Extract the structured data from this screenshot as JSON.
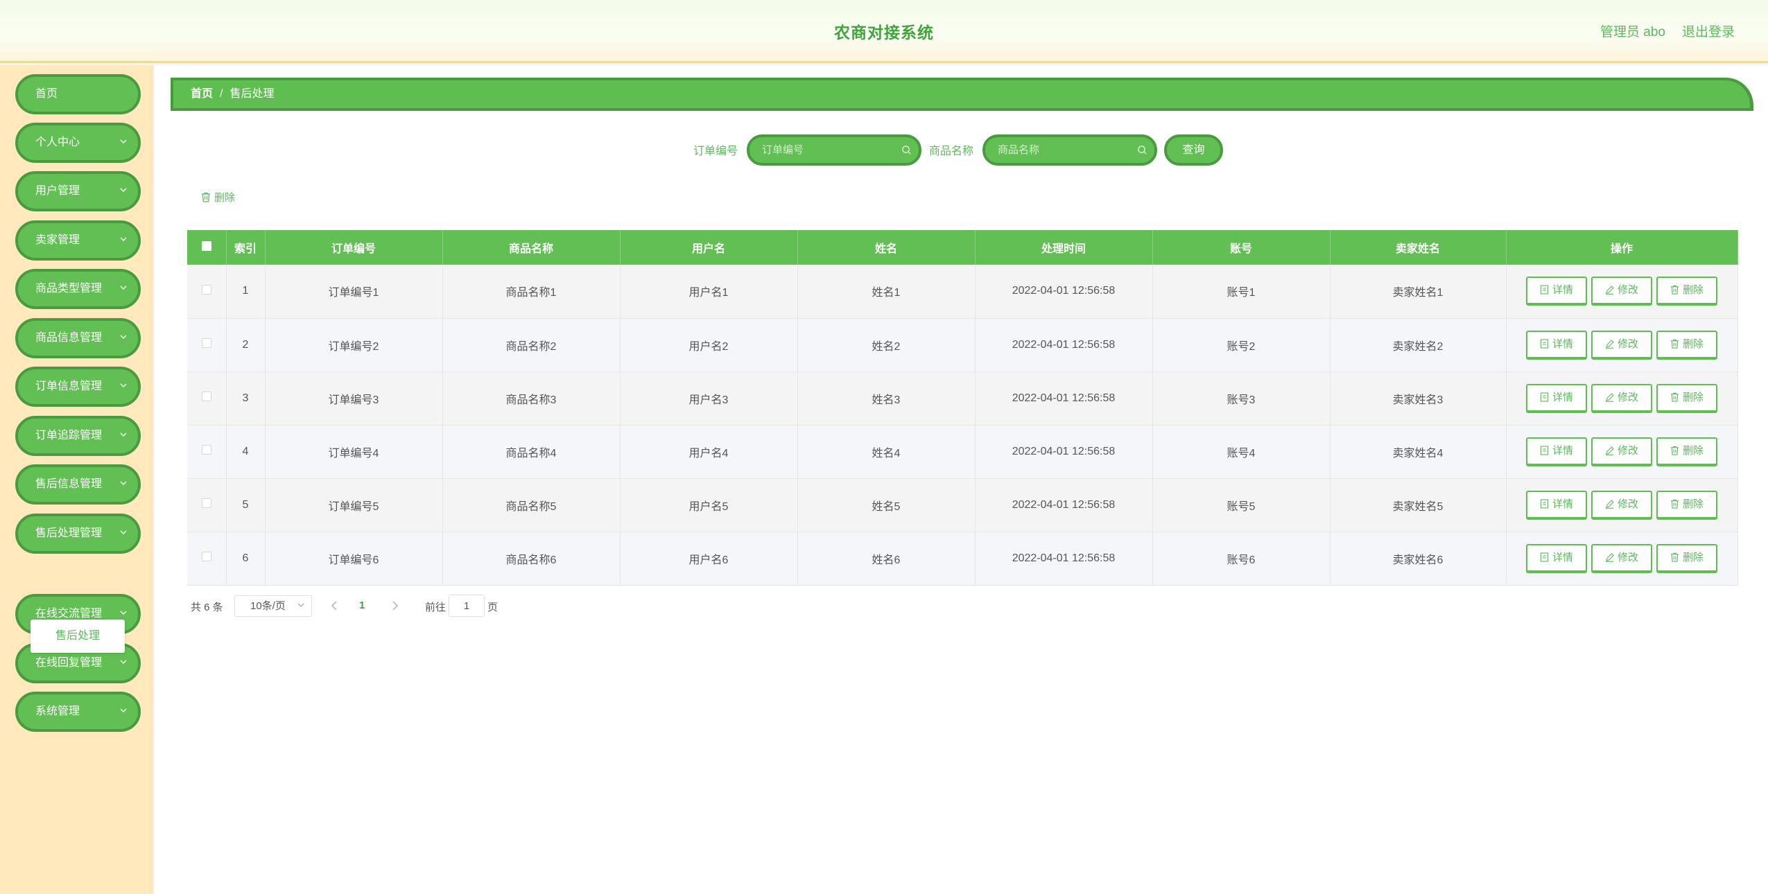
{
  "header": {
    "title": "农商对接系统",
    "admin": "管理员 abo",
    "logout": "退出登录"
  },
  "sidebar": {
    "items": [
      {
        "label": "首页",
        "has_children": false
      },
      {
        "label": "个人中心",
        "has_children": true
      },
      {
        "label": "用户管理",
        "has_children": true
      },
      {
        "label": "卖家管理",
        "has_children": true
      },
      {
        "label": "商品类型管理",
        "has_children": true
      },
      {
        "label": "商品信息管理",
        "has_children": true
      },
      {
        "label": "订单信息管理",
        "has_children": true
      },
      {
        "label": "订单追踪管理",
        "has_children": true
      },
      {
        "label": "售后信息管理",
        "has_children": true
      },
      {
        "label": "售后处理管理",
        "has_children": true
      },
      {
        "label": "在线交流管理",
        "has_children": true
      },
      {
        "label": "在线回复管理",
        "has_children": true
      },
      {
        "label": "系统管理",
        "has_children": true
      }
    ],
    "active_sub": "售后处理"
  },
  "breadcrumb": {
    "home": "首页",
    "separator": "/",
    "current": "售后处理"
  },
  "search": {
    "order_label": "订单编号",
    "order_placeholder": "订单编号",
    "product_label": "商品名称",
    "product_placeholder": "商品名称",
    "query": "查询"
  },
  "actions": {
    "batch_delete": "删除"
  },
  "table": {
    "headers": [
      "索引",
      "订单编号",
      "商品名称",
      "用户名",
      "姓名",
      "处理时间",
      "账号",
      "卖家姓名",
      "操作"
    ],
    "rows": [
      {
        "index": "1",
        "order_no": "订单编号1",
        "product": "商品名称1",
        "username": "用户名1",
        "name": "姓名1",
        "time": "2022-04-01 12:56:58",
        "account": "账号1",
        "seller": "卖家姓名1"
      },
      {
        "index": "2",
        "order_no": "订单编号2",
        "product": "商品名称2",
        "username": "用户名2",
        "name": "姓名2",
        "time": "2022-04-01 12:56:58",
        "account": "账号2",
        "seller": "卖家姓名2"
      },
      {
        "index": "3",
        "order_no": "订单编号3",
        "product": "商品名称3",
        "username": "用户名3",
        "name": "姓名3",
        "time": "2022-04-01 12:56:58",
        "account": "账号3",
        "seller": "卖家姓名3"
      },
      {
        "index": "4",
        "order_no": "订单编号4",
        "product": "商品名称4",
        "username": "用户名4",
        "name": "姓名4",
        "time": "2022-04-01 12:56:58",
        "account": "账号4",
        "seller": "卖家姓名4"
      },
      {
        "index": "5",
        "order_no": "订单编号5",
        "product": "商品名称5",
        "username": "用户名5",
        "name": "姓名5",
        "time": "2022-04-01 12:56:58",
        "account": "账号5",
        "seller": "卖家姓名5"
      },
      {
        "index": "6",
        "order_no": "订单编号6",
        "product": "商品名称6",
        "username": "用户名6",
        "name": "姓名6",
        "time": "2022-04-01 12:56:58",
        "account": "账号6",
        "seller": "卖家姓名6"
      }
    ],
    "op_detail": "详情",
    "op_edit": "修改",
    "op_delete": "删除"
  },
  "pagination": {
    "total": "共 6 条",
    "page_size": "10条/页",
    "current_page": "1",
    "goto_label": "前往",
    "goto_value": "1",
    "page_suffix": "页"
  },
  "colors": {
    "primary": "#62bf54",
    "primary_border": "#4a9a3f",
    "sidebar_bg": "#ffe9bd",
    "title_text": "#3ea53a"
  }
}
